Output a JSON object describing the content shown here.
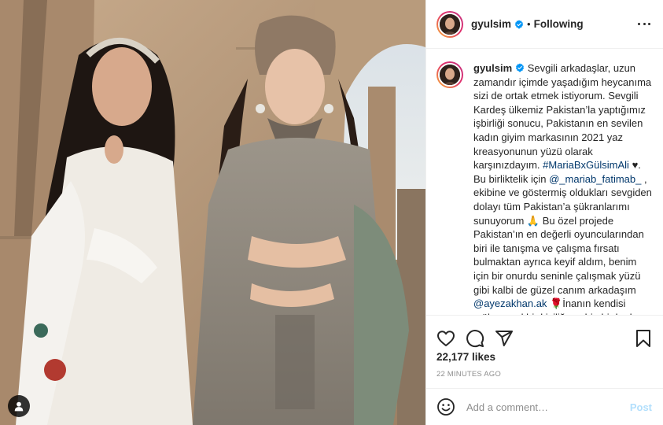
{
  "post": {
    "image_alt": "",
    "colors": {
      "accent": "#0095f6",
      "link": "#00376b",
      "muted": "#8e8e8e",
      "border": "#efefef"
    }
  },
  "header": {
    "username": "gyulsim",
    "separator": "•",
    "follow_state": "Following",
    "icons": [
      "verified-badge-icon",
      "more-options-icon"
    ]
  },
  "caption": {
    "username": "gyulsim",
    "part1": " Sevgili arkadaşlar, uzun zamandır içimde yaşadığım heycanıma sizi de ortak etmek istiyorum. Sevgili Kardeş ülkemiz Pakistan’la yaptığımız işbirliği sonucu, Pakistanın en sevilen kadın giyim markasının 2021 yaz kreasyonunun yüzü olarak karşınızdayım. ",
    "hashtag": "#MariaBxGülsimAli",
    "part2": " ♥. Bu birliktelik için ",
    "mention1": "@_mariab_fatimab_",
    "part3": " , ekibine ve göstermiş oldukları sevgiden dolayı tüm Pakistan’a şükranlarımı sunuyorum 🙏 Bu özel projede Pakistan’ın en değerli oyuncularından biri ile tanışma ve çalışma fırsatı bulmaktan ayrıca keyif aldım, benim için bir onurdu seninle çalışmak yüzü gibi kalbi de güzel canım arkadaşım ",
    "mention2": "@ayezakhan.ak",
    "part4": " 🌹İnanın kendisi mükemmel bir kişiliğe sahip bir kadın"
  },
  "actions": {
    "icons": [
      "heart-icon",
      "comment-icon",
      "share-icon",
      "bookmark-icon"
    ]
  },
  "likes": "22,177 likes",
  "timestamp": "22 MINUTES AGO",
  "comment_box": {
    "placeholder": "Add a comment…",
    "post_label": "Post",
    "icon": "emoji-icon"
  }
}
